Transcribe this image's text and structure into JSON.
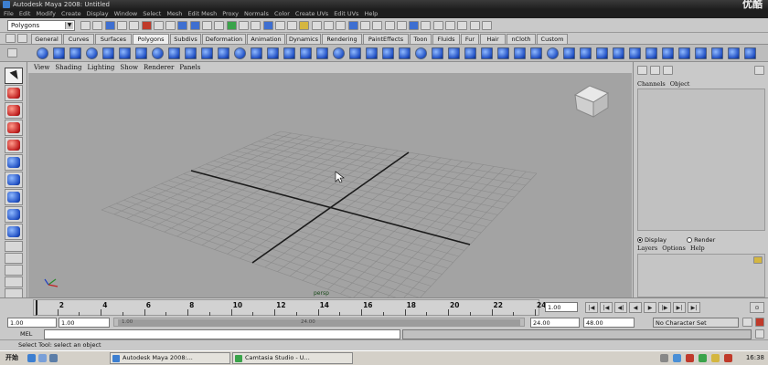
{
  "window": {
    "title": "Autodesk Maya 2008:   Untitled",
    "watermark": "优酷"
  },
  "menubar": [
    "File",
    "Edit",
    "Modify",
    "Create",
    "Display",
    "Window",
    "Select",
    "Mesh",
    "Edit Mesh",
    "Proxy",
    "Normals",
    "Color",
    "Create UVs",
    "Edit UVs",
    "Help"
  ],
  "status": {
    "mode": "Polygons"
  },
  "shelf_tabs": [
    "General",
    "Curves",
    "Surfaces",
    "Polygons",
    "Subdivs",
    "Deformation",
    "Animation",
    "Dynamics",
    "Rendering",
    "PaintEffects",
    "Toon",
    "Fluids",
    "Fur",
    "Hair",
    "nCloth",
    "Custom"
  ],
  "shelf_active": "Polygons",
  "panel_menu": [
    "View",
    "Shading",
    "Lighting",
    "Show",
    "Renderer",
    "Panels"
  ],
  "viewport": {
    "camera": "persp"
  },
  "channel_box": {
    "menu": [
      "Channels",
      "Object"
    ],
    "display_label": "Display",
    "render_label": "Render",
    "layer_menu": [
      "Layers",
      "Options",
      "Help"
    ]
  },
  "timeline": {
    "ticks": [
      "2",
      "4",
      "6",
      "8",
      "10",
      "12",
      "14",
      "16",
      "18",
      "20",
      "22",
      "24"
    ],
    "current_frame": "1.00"
  },
  "range": {
    "start_outer": "1.00",
    "start_inner": "1.00",
    "slider_start": "1.00",
    "slider_end": "24.00",
    "end_inner": "24.00",
    "end_outer": "48.00",
    "character_set": "No Character Set"
  },
  "mel": {
    "label": "MEL"
  },
  "help_line": "Select Tool: select an object",
  "taskbar": {
    "start": "开始",
    "tasks": [
      "Autodesk Maya 2008:...",
      "Camtasia Studio - U..."
    ],
    "clock": "16:38"
  },
  "colors": {
    "viewport_bg": "#a3a3a3",
    "grid": "#8b8b8b",
    "axis": "#1a1a1a"
  }
}
